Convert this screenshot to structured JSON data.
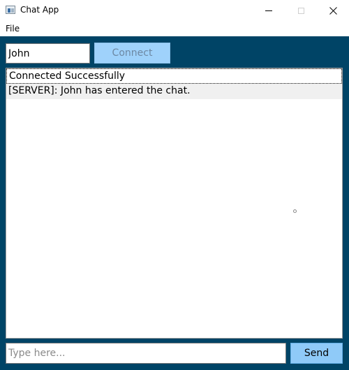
{
  "window": {
    "title": "Chat App",
    "icon": "app-window-icon",
    "buttons": [
      "minimize-icon",
      "maximize-icon",
      "close-icon"
    ],
    "close_glyph": "✕"
  },
  "menu": {
    "items": [
      {
        "label": "File"
      }
    ]
  },
  "connection": {
    "username_value": "John",
    "connect_label": "Connect",
    "connect_enabled": false
  },
  "chat": {
    "messages": [
      {
        "text": "Connected Successfully",
        "selected": true
      },
      {
        "text": "[SERVER]: John has entered the chat."
      }
    ]
  },
  "compose": {
    "placeholder": "Type here...",
    "value": "",
    "send_label": "Send"
  },
  "colors": {
    "client_background": "#004466",
    "button_blue": "#8fcaf8",
    "disabled_text": "#6d88a3"
  }
}
